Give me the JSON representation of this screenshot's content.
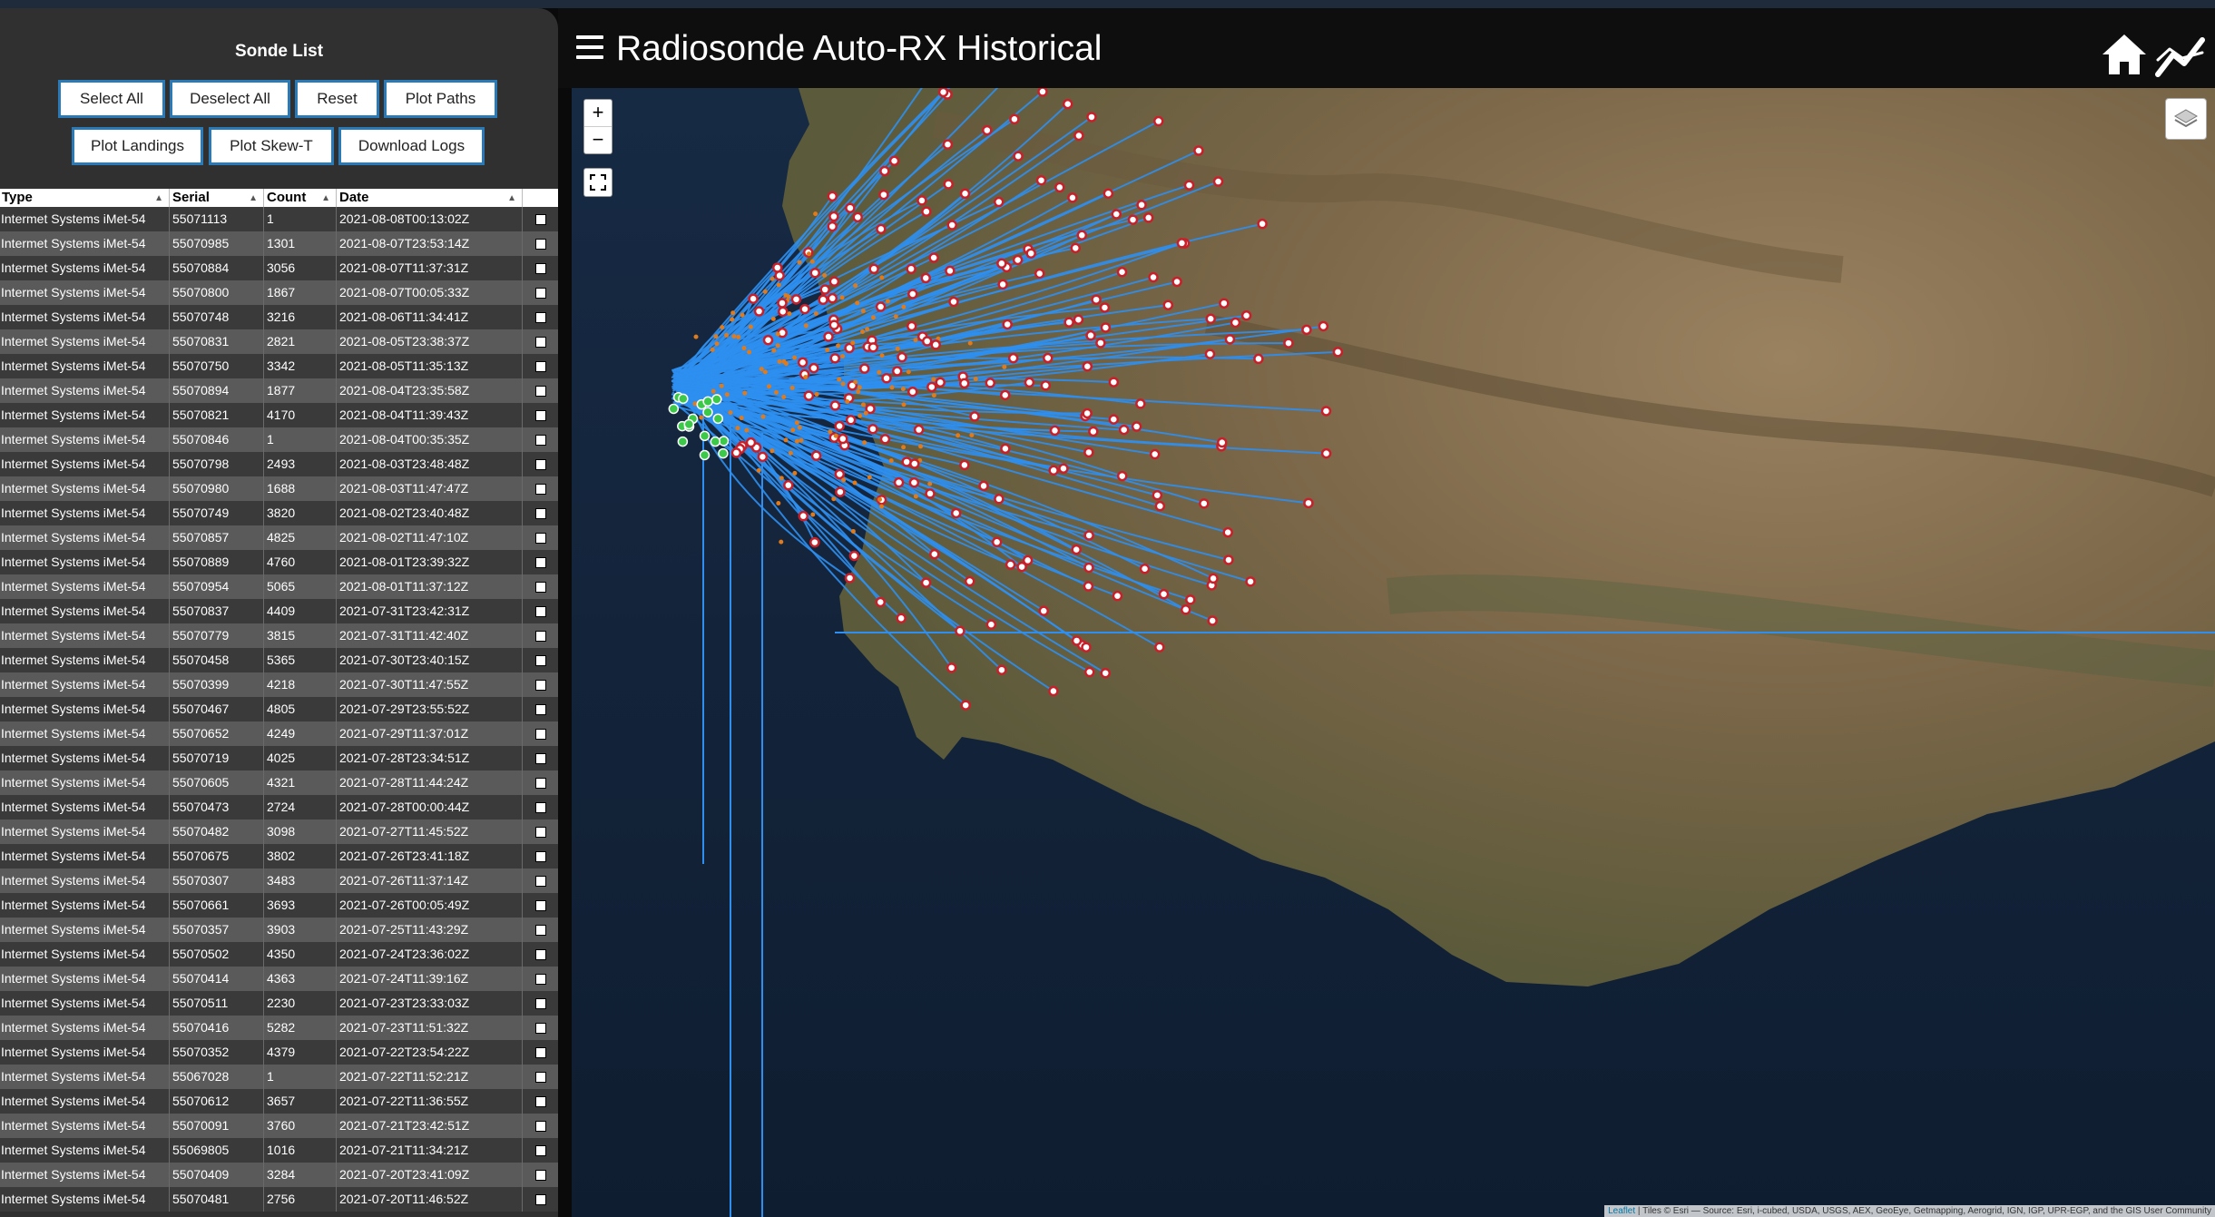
{
  "header": {
    "title": "Radiosonde Auto-RX Historical",
    "menu_icon": "hamburger-menu-icon",
    "home_icon": "home-icon",
    "chart_icon": "chart-line-icon"
  },
  "sidebar": {
    "title": "Sonde List",
    "buttons": [
      "Select All",
      "Deselect All",
      "Reset",
      "Plot Paths",
      "Plot Landings",
      "Plot Skew-T",
      "Download Logs"
    ],
    "columns": [
      "Type",
      "Serial",
      "Count",
      "Date"
    ],
    "rows": [
      [
        "Intermet Systems iMet-54",
        "55071113",
        "1",
        "2021-08-08T00:13:02Z"
      ],
      [
        "Intermet Systems iMet-54",
        "55070985",
        "1301",
        "2021-08-07T23:53:14Z"
      ],
      [
        "Intermet Systems iMet-54",
        "55070884",
        "3056",
        "2021-08-07T11:37:31Z"
      ],
      [
        "Intermet Systems iMet-54",
        "55070800",
        "1867",
        "2021-08-07T00:05:33Z"
      ],
      [
        "Intermet Systems iMet-54",
        "55070748",
        "3216",
        "2021-08-06T11:34:41Z"
      ],
      [
        "Intermet Systems iMet-54",
        "55070831",
        "2821",
        "2021-08-05T23:38:37Z"
      ],
      [
        "Intermet Systems iMet-54",
        "55070750",
        "3342",
        "2021-08-05T11:35:13Z"
      ],
      [
        "Intermet Systems iMet-54",
        "55070894",
        "1877",
        "2021-08-04T23:35:58Z"
      ],
      [
        "Intermet Systems iMet-54",
        "55070821",
        "4170",
        "2021-08-04T11:39:43Z"
      ],
      [
        "Intermet Systems iMet-54",
        "55070846",
        "1",
        "2021-08-04T00:35:35Z"
      ],
      [
        "Intermet Systems iMet-54",
        "55070798",
        "2493",
        "2021-08-03T23:48:48Z"
      ],
      [
        "Intermet Systems iMet-54",
        "55070980",
        "1688",
        "2021-08-03T11:47:47Z"
      ],
      [
        "Intermet Systems iMet-54",
        "55070749",
        "3820",
        "2021-08-02T23:40:48Z"
      ],
      [
        "Intermet Systems iMet-54",
        "55070857",
        "4825",
        "2021-08-02T11:47:10Z"
      ],
      [
        "Intermet Systems iMet-54",
        "55070889",
        "4760",
        "2021-08-01T23:39:32Z"
      ],
      [
        "Intermet Systems iMet-54",
        "55070954",
        "5065",
        "2021-08-01T11:37:12Z"
      ],
      [
        "Intermet Systems iMet-54",
        "55070837",
        "4409",
        "2021-07-31T23:42:31Z"
      ],
      [
        "Intermet Systems iMet-54",
        "55070779",
        "3815",
        "2021-07-31T11:42:40Z"
      ],
      [
        "Intermet Systems iMet-54",
        "55070458",
        "5365",
        "2021-07-30T23:40:15Z"
      ],
      [
        "Intermet Systems iMet-54",
        "55070399",
        "4218",
        "2021-07-30T11:47:55Z"
      ],
      [
        "Intermet Systems iMet-54",
        "55070467",
        "4805",
        "2021-07-29T23:55:52Z"
      ],
      [
        "Intermet Systems iMet-54",
        "55070652",
        "4249",
        "2021-07-29T11:37:01Z"
      ],
      [
        "Intermet Systems iMet-54",
        "55070719",
        "4025",
        "2021-07-28T23:34:51Z"
      ],
      [
        "Intermet Systems iMet-54",
        "55070605",
        "4321",
        "2021-07-28T11:44:24Z"
      ],
      [
        "Intermet Systems iMet-54",
        "55070473",
        "2724",
        "2021-07-28T00:00:44Z"
      ],
      [
        "Intermet Systems iMet-54",
        "55070482",
        "3098",
        "2021-07-27T11:45:52Z"
      ],
      [
        "Intermet Systems iMet-54",
        "55070675",
        "3802",
        "2021-07-26T23:41:18Z"
      ],
      [
        "Intermet Systems iMet-54",
        "55070307",
        "3483",
        "2021-07-26T11:37:14Z"
      ],
      [
        "Intermet Systems iMet-54",
        "55070661",
        "3693",
        "2021-07-26T00:05:49Z"
      ],
      [
        "Intermet Systems iMet-54",
        "55070357",
        "3903",
        "2021-07-25T11:43:29Z"
      ],
      [
        "Intermet Systems iMet-54",
        "55070502",
        "4350",
        "2021-07-24T23:36:02Z"
      ],
      [
        "Intermet Systems iMet-54",
        "55070414",
        "4363",
        "2021-07-24T11:39:16Z"
      ],
      [
        "Intermet Systems iMet-54",
        "55070511",
        "2230",
        "2021-07-23T23:33:03Z"
      ],
      [
        "Intermet Systems iMet-54",
        "55070416",
        "5282",
        "2021-07-23T11:51:32Z"
      ],
      [
        "Intermet Systems iMet-54",
        "55070352",
        "4379",
        "2021-07-22T23:54:22Z"
      ],
      [
        "Intermet Systems iMet-54",
        "55067028",
        "1",
        "2021-07-22T11:52:21Z"
      ],
      [
        "Intermet Systems iMet-54",
        "55070612",
        "3657",
        "2021-07-22T11:36:55Z"
      ],
      [
        "Intermet Systems iMet-54",
        "55070091",
        "3760",
        "2021-07-21T23:42:51Z"
      ],
      [
        "Intermet Systems iMet-54",
        "55069805",
        "1016",
        "2021-07-21T11:34:21Z"
      ],
      [
        "Intermet Systems iMet-54",
        "55070409",
        "3284",
        "2021-07-20T23:41:09Z"
      ],
      [
        "Intermet Systems iMet-54",
        "55070481",
        "2756",
        "2021-07-20T11:46:52Z"
      ]
    ]
  },
  "map": {
    "zoom_in": "+",
    "zoom_out": "−",
    "leaflet_link": "Leaflet",
    "attribution": " | Tiles © Esri — Source: Esri, i-cubed, USDA, USGS, AEX, GeoEye, Getmapping, Aerogrid, IGN, IGP, UPR-EGP, and the GIS User Community",
    "colors": {
      "ocean": "#14243a",
      "land": "#7a6648",
      "track": "#2e8ff0",
      "landing": "#c8202a",
      "launch": "#3cc94a"
    }
  }
}
